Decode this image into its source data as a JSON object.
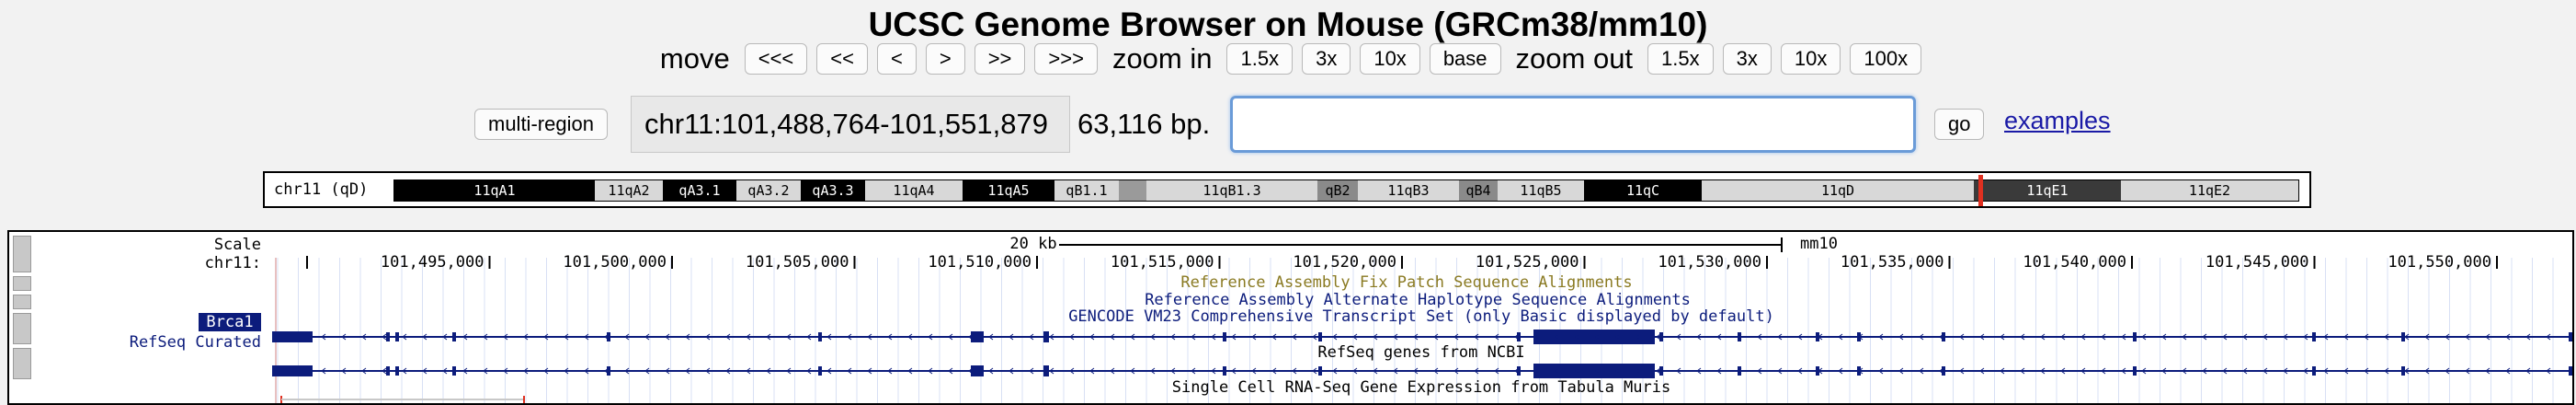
{
  "title": "UCSC Genome Browser on Mouse (GRCm38/mm10)",
  "nav": {
    "move_label": "move",
    "move_buttons": [
      "<<<",
      "<<",
      "<",
      ">",
      ">>",
      ">>>"
    ],
    "zoom_in_label": "zoom in",
    "zoom_in_buttons": [
      "1.5x",
      "3x",
      "10x",
      "base"
    ],
    "zoom_out_label": "zoom out",
    "zoom_out_buttons": [
      "1.5x",
      "3x",
      "10x",
      "100x"
    ]
  },
  "position": {
    "multi_region_label": "multi-region",
    "coordinates": "chr11:101,488,764-101,551,879",
    "size": "63,116 bp.",
    "search_value": "",
    "go_label": "go",
    "examples_label": "examples"
  },
  "ideogram": {
    "chrom_label": "chr11 (qD)",
    "bands": [
      "11qA1",
      "11qA2",
      "qA3.1",
      "qA3.2",
      "qA3.3",
      "11qA4",
      "11qA5",
      "qB1.1",
      "11qB1.3",
      "qB2",
      "11qB3",
      "qB4",
      "11qB5",
      "11qC",
      "11qD",
      "11qE1",
      "11qE2"
    ],
    "colors": {
      "highlight": "#e03020"
    }
  },
  "tracks": {
    "scale_label": "Scale",
    "chrom_label": "chr11:",
    "scale_bar": "20 kb",
    "assembly": "mm10",
    "ticks": [
      "101,495,000",
      "101,500,000",
      "101,505,000",
      "101,510,000",
      "101,515,000",
      "101,520,000",
      "101,525,000",
      "101,530,000",
      "101,535,000",
      "101,540,000",
      "101,545,000",
      "101,550,000"
    ],
    "track_titles": [
      "Reference Assembly Fix Patch Sequence Alignments",
      "Reference Assembly Alternate Haplotype Sequence Alignments",
      "GENCODE VM23 Comprehensive Transcript Set (only Basic displayed by default)",
      "RefSeq genes from NCBI",
      "Single Cell RNA-Seq Gene Expression from Tabula Muris"
    ],
    "gene_label": "Brca1",
    "refseq_label": "RefSeq Curated",
    "colors": {
      "gene": "#0c1c7c",
      "fixpatch": "#8a7a22",
      "dark_blue": "#0c1c7c"
    }
  }
}
